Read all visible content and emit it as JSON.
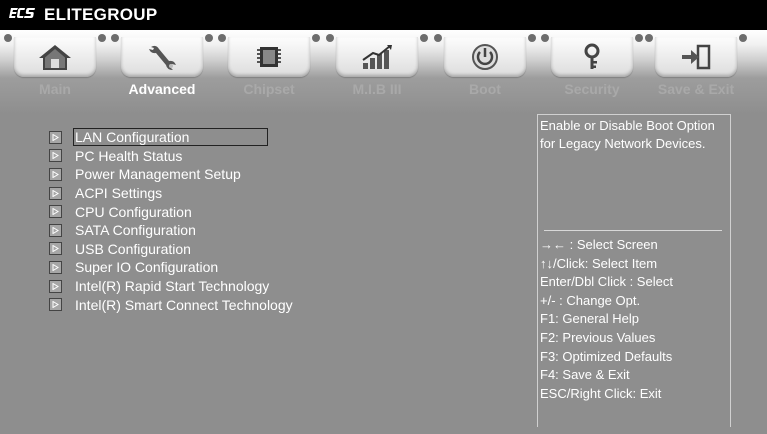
{
  "brand": {
    "logo_text": "ECS",
    "name": "ELITEGROUP"
  },
  "tabs": [
    {
      "label": "Main",
      "icon": "home-icon",
      "active": false
    },
    {
      "label": "Advanced",
      "icon": "wrench-icon",
      "active": true
    },
    {
      "label": "Chipset",
      "icon": "chip-icon",
      "active": false
    },
    {
      "label": "M.I.B III",
      "icon": "bar-chart-icon",
      "active": false
    },
    {
      "label": "Boot",
      "icon": "power-icon",
      "active": false
    },
    {
      "label": "Security",
      "icon": "key-icon",
      "active": false
    },
    {
      "label": "Save & Exit",
      "icon": "exit-icon",
      "active": false
    }
  ],
  "menu": {
    "selected_index": 0,
    "items": [
      "LAN Configuration",
      "PC Health Status",
      "Power Management Setup",
      "ACPI Settings",
      "CPU Configuration",
      "SATA Configuration",
      "USB Configuration",
      "Super IO Configuration",
      "Intel(R) Rapid Start Technology",
      "Intel(R) Smart Connect Technology"
    ]
  },
  "help": {
    "description": "Enable or Disable Boot Option for Legacy Network Devices.",
    "keys": [
      "→←  : Select Screen",
      "↑↓/Click: Select Item",
      "Enter/Dbl Click : Select",
      "+/- : Change Opt.",
      "F1: General Help",
      "F2: Previous Values",
      "F3: Optimized Defaults",
      "F4: Save & Exit",
      "ESC/Right Click: Exit"
    ]
  },
  "colors": {
    "background": "#8e8e8e",
    "topbar": "#000000",
    "text": "#ffffff",
    "inactive_tab_label": "#a9a9a9"
  }
}
